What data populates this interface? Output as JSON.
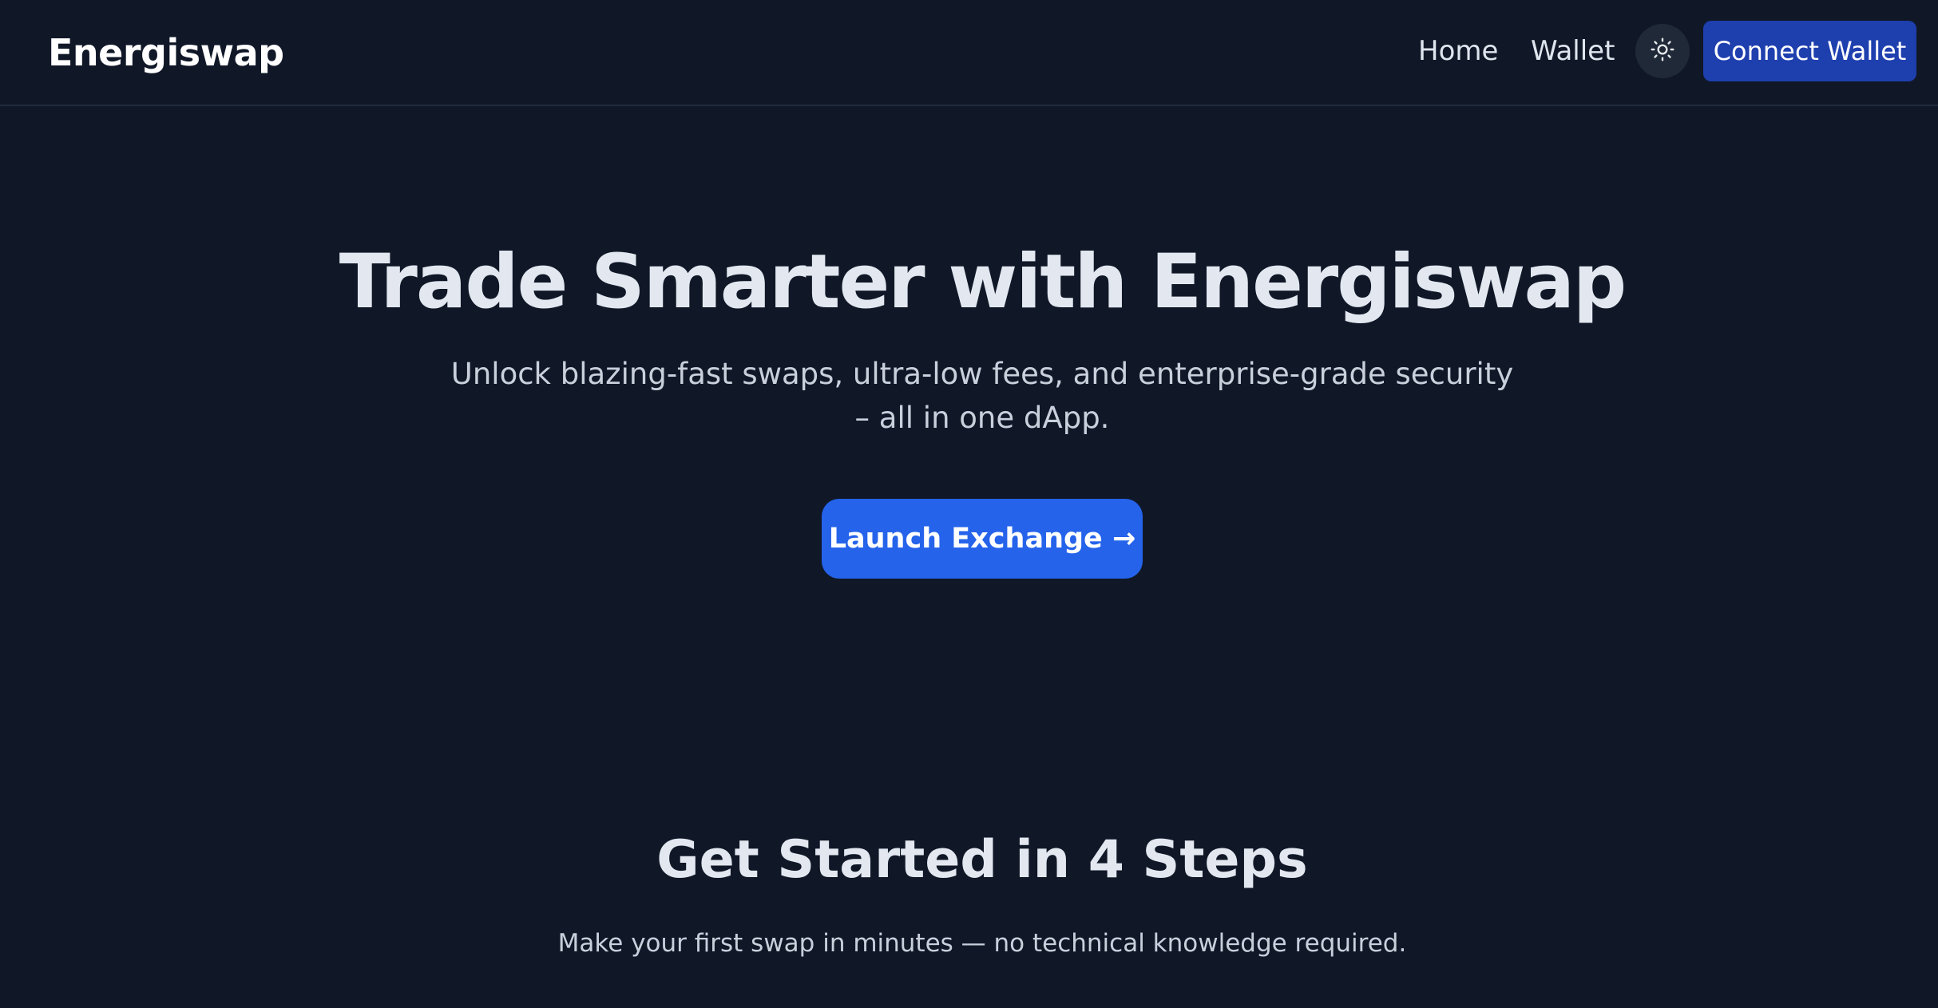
{
  "header": {
    "brand": "Energiswap",
    "nav": {
      "home": "Home",
      "wallet": "Wallet"
    },
    "theme_toggle_icon": "sun-icon",
    "connect_label": "Connect Wallet"
  },
  "hero": {
    "title": "Trade Smarter with Energiswap",
    "subtitle": "Unlock blazing-fast swaps, ultra-low fees, and enterprise-grade security – all in one dApp.",
    "cta_label": "Launch Exchange →"
  },
  "steps": {
    "title": "Get Started in 4 Steps",
    "subtitle": "Make your first swap in minutes — no technical knowledge required."
  },
  "colors": {
    "background": "#101828",
    "connect_button": "#1e3fae",
    "cta_button": "#2563eb",
    "toggle_bg": "#1f2937"
  }
}
